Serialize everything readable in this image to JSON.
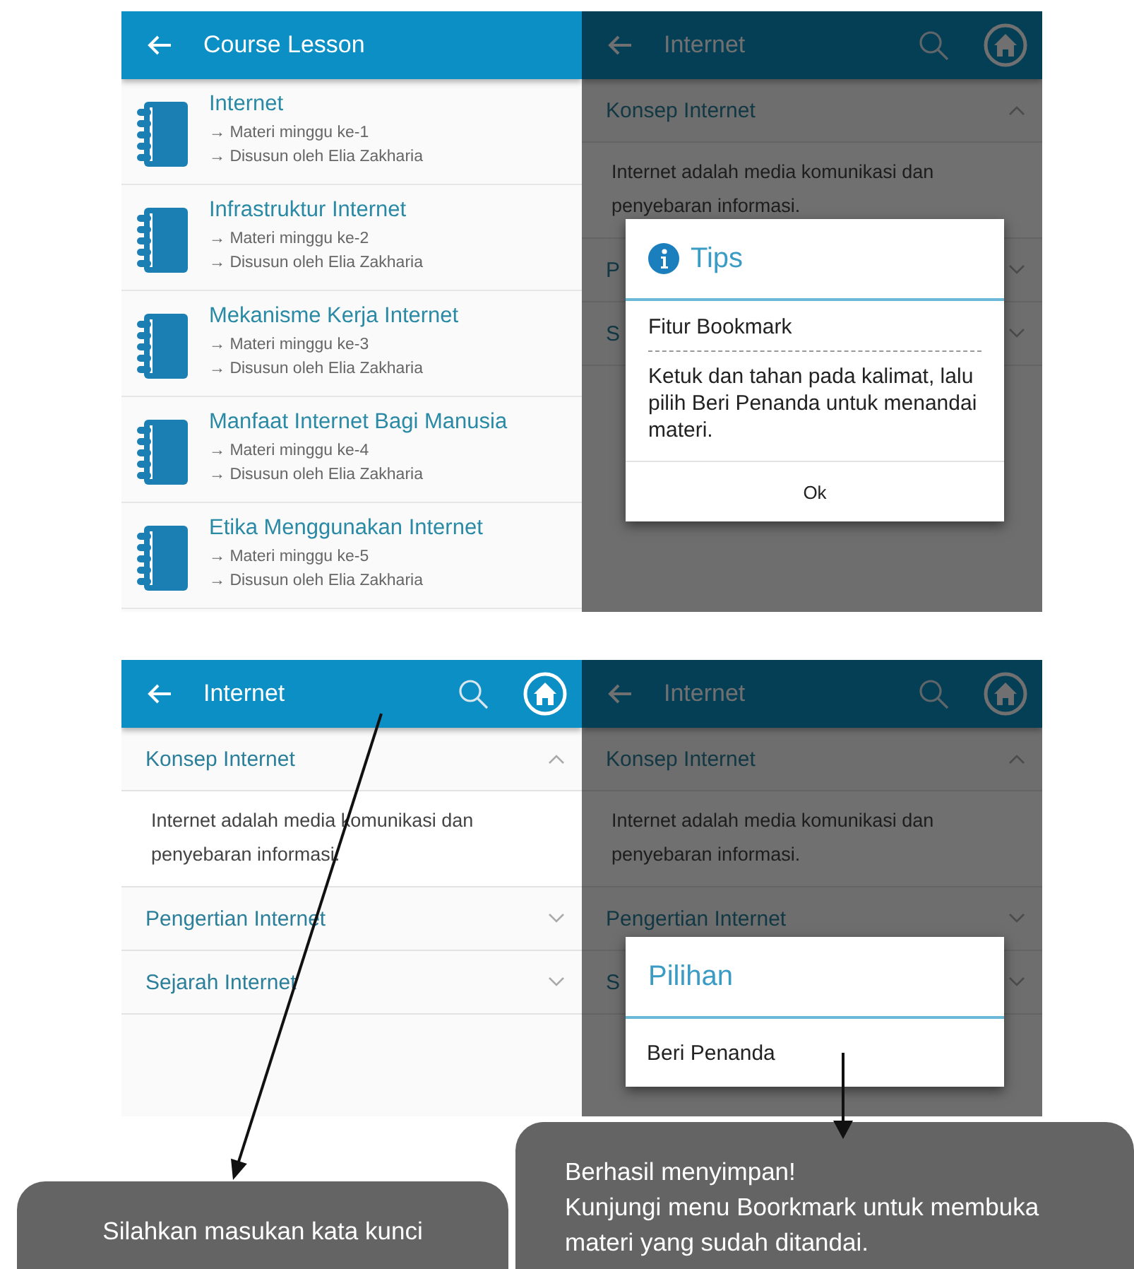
{
  "panels": [
    {
      "kind": "lessons",
      "title": "Course Lesson",
      "dimmed": false,
      "items": [
        {
          "title": "Internet",
          "lines": [
            "→ Materi minggu ke-1",
            "→ Disusun oleh Elia Zakharia"
          ]
        },
        {
          "title": "Infrastruktur Internet",
          "lines": [
            "→ Materi minggu ke-2",
            "→ Disusun oleh Elia Zakharia"
          ]
        },
        {
          "title": "Mekanisme Kerja Internet",
          "lines": [
            "→ Materi minggu ke-3",
            "→ Disusun oleh Elia Zakharia"
          ]
        },
        {
          "title": "Manfaat Internet Bagi Manusia",
          "lines": [
            "→ Materi minggu ke-4",
            "→ Disusun oleh Elia Zakharia"
          ]
        },
        {
          "title": "Etika Menggunakan Internet",
          "lines": [
            "→ Materi minggu ke-5",
            "→ Disusun oleh Elia Zakharia"
          ]
        }
      ]
    },
    {
      "kind": "accordion",
      "title": "Internet",
      "dimmed": true,
      "sections": [
        {
          "title": "Konsep Internet",
          "expanded": true,
          "body": "Internet adalah media komunikasi dan penyebaran informasi."
        },
        {
          "title": "P",
          "expanded": false
        },
        {
          "title": "S",
          "expanded": false
        }
      ],
      "dialog": {
        "kind": "tips",
        "title": "Tips",
        "heading": "Fitur Bookmark",
        "message": "Ketuk dan tahan pada kalimat, lalu pilih Beri Penanda untuk menandai materi.",
        "button": "Ok"
      }
    },
    {
      "kind": "accordion",
      "title": "Internet",
      "dimmed": false,
      "sections": [
        {
          "title": "Konsep Internet",
          "expanded": true,
          "body": "Internet adalah media komunikasi dan penyebaran informasi."
        },
        {
          "title": "Pengertian Internet",
          "expanded": false
        },
        {
          "title": "Sejarah Internet",
          "expanded": false
        }
      ]
    },
    {
      "kind": "accordion",
      "title": "Internet",
      "dimmed": true,
      "sections": [
        {
          "title": "Konsep Internet",
          "expanded": true,
          "body": "Internet adalah media komunikasi dan penyebaran informasi."
        },
        {
          "title": "Pengertian Internet",
          "expanded": false
        },
        {
          "title": "S",
          "expanded": false
        }
      ],
      "dialog": {
        "kind": "options",
        "title": "Pilihan",
        "items": [
          "Beri Penanda"
        ]
      }
    }
  ],
  "toasts": [
    {
      "lines": [
        "Silahkan masukan kata kunci"
      ]
    },
    {
      "lines": [
        "Berhasil menyimpan!",
        "Kunjungi menu Boorkmark untuk membuka materi yang sudah ditandai."
      ]
    }
  ]
}
